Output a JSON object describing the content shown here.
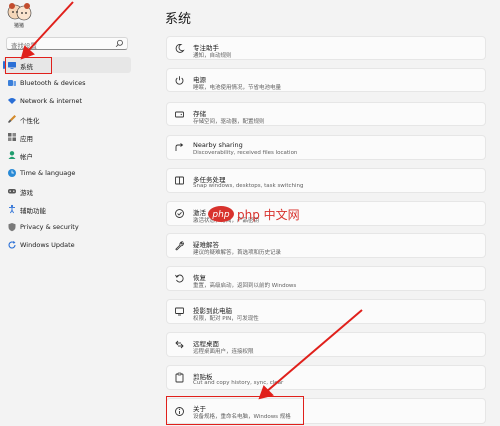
{
  "user": {
    "name": "猪猪"
  },
  "search": {
    "placeholder": "查找设置"
  },
  "sidebar": {
    "items": [
      {
        "label": "系统",
        "icon": "monitor-icon",
        "active": true
      },
      {
        "label": "Bluetooth & devices",
        "icon": "bluetooth-icon"
      },
      {
        "label": "Network & internet",
        "icon": "wifi-icon"
      },
      {
        "label": "个性化",
        "icon": "brush-icon"
      },
      {
        "label": "应用",
        "icon": "apps-icon"
      },
      {
        "label": "帐户",
        "icon": "person-icon"
      },
      {
        "label": "Time & language",
        "icon": "globe-clock-icon"
      },
      {
        "label": "游戏",
        "icon": "gamepad-icon"
      },
      {
        "label": "辅助功能",
        "icon": "accessibility-icon"
      },
      {
        "label": "Privacy & security",
        "icon": "shield-icon"
      },
      {
        "label": "Windows Update",
        "icon": "update-icon"
      }
    ]
  },
  "main": {
    "title": "系统",
    "cards": [
      {
        "title": "专注助手",
        "desc": "通知，自动规则",
        "icon": "moon-icon"
      },
      {
        "title": "电源",
        "desc": "睡眠，电池使用情况，节省电池电量",
        "icon": "power-icon"
      },
      {
        "title": "存储",
        "desc": "存储空间，驱动器，配置规则",
        "icon": "storage-icon"
      },
      {
        "title": "Nearby sharing",
        "desc": "Discoverability, received files location",
        "icon": "share-icon"
      },
      {
        "title": "多任务处理",
        "desc": "Snap windows, desktops, task switching",
        "icon": "multitask-icon"
      },
      {
        "title": "激活",
        "desc": "激活状态，订阅，产品密钥",
        "icon": "check-circle-icon"
      },
      {
        "title": "疑难解答",
        "desc": "建议的疑难解答，首选项和历史记录",
        "icon": "wrench-icon"
      },
      {
        "title": "恢复",
        "desc": "重置，高级启动，返回到以前的 Windows",
        "icon": "recovery-icon"
      },
      {
        "title": "投影到此电脑",
        "desc": "权限，配对 PIN，可发现性",
        "icon": "project-icon"
      },
      {
        "title": "远程桌面",
        "desc": "远程桌面用户，连接权限",
        "icon": "remote-desktop-icon"
      },
      {
        "title": "剪贴板",
        "desc": "Cut and copy history, sync, clear",
        "icon": "clipboard-icon"
      },
      {
        "title": "关于",
        "desc": "设备规格，重命名电脑，Windows 规格",
        "icon": "info-icon"
      }
    ]
  },
  "watermark": {
    "text": "php 中文网"
  },
  "colors": {
    "accent": "#2a6fd6",
    "annotation": "#e0201b"
  }
}
